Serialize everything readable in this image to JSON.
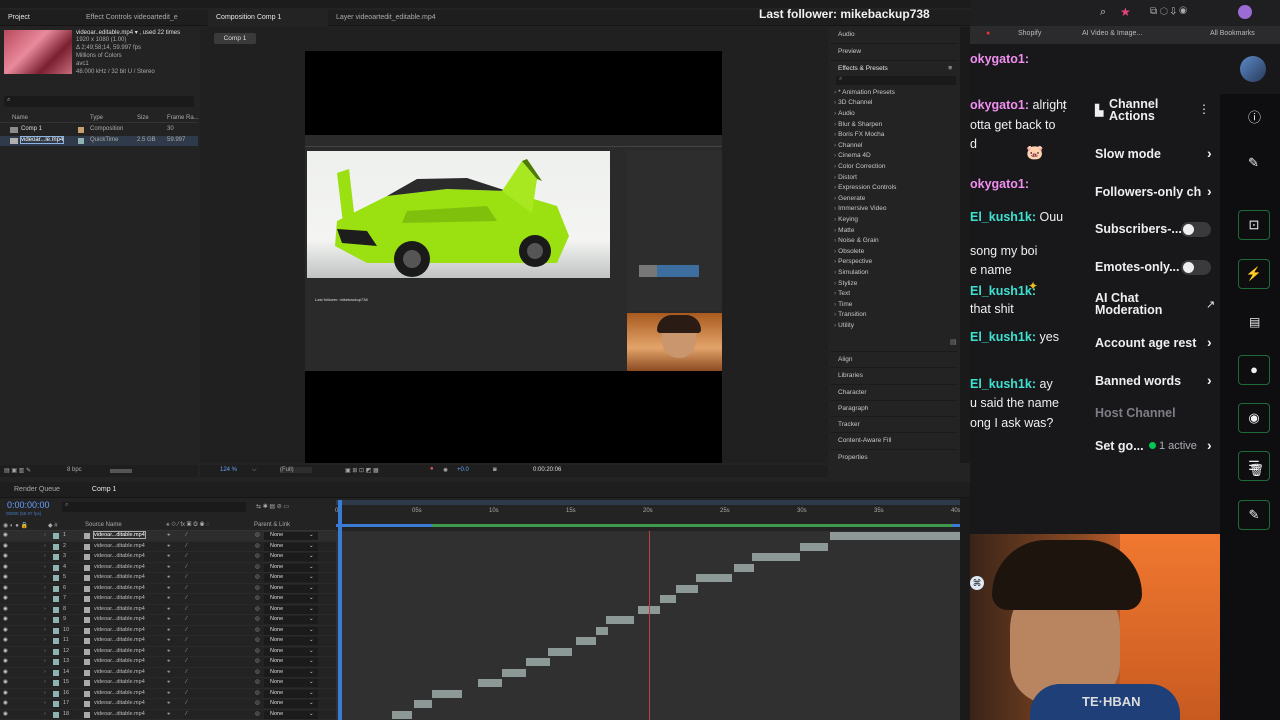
{
  "overlay": {
    "last_follower": "Last follower: mikebackup738"
  },
  "ae": {
    "tabs": {
      "project": "Project",
      "effect_controls": "Effect Controls videoartedit_e",
      "composition": "Composition Comp 1",
      "layer": "Layer videoartedit_editable.mp4"
    },
    "comp_chip": "Comp 1",
    "footage_info": {
      "name": "videoar..editable.mp4 ▾ , used 22 times",
      "res": "1920 x 1080 (1.00)",
      "dur": "Δ 2;49;58;14, 59.997 fps",
      "colors": "Millions of Colors",
      "codec": "avc1",
      "audio": "48.000 kHz / 32 bit U / Stereo"
    },
    "project_headers": {
      "name": "Name",
      "type": "Type",
      "size": "Size",
      "frame": "Frame Ra..."
    },
    "project_items": [
      {
        "name": "Comp 1",
        "type": "Composition",
        "size": "",
        "frame": "30"
      },
      {
        "name": "videoar...le.mp4",
        "type": "QuickTime",
        "size": "2.5 GB",
        "frame": "59.997"
      }
    ],
    "bpc": "8 bpc",
    "viewer": {
      "zoom": "124 %",
      "quality": "(Full)",
      "timecode": "0:00:20:06",
      "exposure": "+0.0"
    },
    "right_panels": {
      "audio": "Audio",
      "preview": "Preview",
      "effects_presets": "Effects & Presets"
    },
    "effects": [
      "* Animation Presets",
      "3D Channel",
      "Audio",
      "Blur & Sharpen",
      "Boris FX Mocha",
      "Channel",
      "Cinema 4D",
      "Color Correction",
      "Distort",
      "Expression Controls",
      "Generate",
      "Immersive Video",
      "Keying",
      "Matte",
      "Noise & Grain",
      "Obsolete",
      "Perspective",
      "Simulation",
      "Stylize",
      "Text",
      "Time",
      "Transition",
      "Utility"
    ],
    "lower_panels": [
      "Align",
      "Libraries",
      "Character",
      "Paragraph",
      "Tracker",
      "Content-Aware Fill",
      "Properties"
    ],
    "timeline": {
      "render_queue": "Render Queue",
      "comp_tab": "Comp 1",
      "timecode": "0:00:00:00",
      "timecode_sub": "00000 (59.97 fps)",
      "col_source": "Source Name",
      "col_parent": "Parent & Link",
      "ruler": [
        "0s",
        "05s",
        "10s",
        "15s",
        "20s",
        "25s",
        "30s",
        "35s",
        "40s"
      ],
      "layers": [
        {
          "num": "1",
          "name": "videoar...ditable.mp4",
          "parent": "None"
        },
        {
          "num": "2",
          "name": "videoar...ditable.mp4",
          "parent": "None"
        },
        {
          "num": "3",
          "name": "videoar...ditable.mp4",
          "parent": "None"
        },
        {
          "num": "4",
          "name": "videoar...ditable.mp4",
          "parent": "None"
        },
        {
          "num": "5",
          "name": "videoar...ditable.mp4",
          "parent": "None"
        },
        {
          "num": "6",
          "name": "videoar...ditable.mp4",
          "parent": "None"
        },
        {
          "num": "7",
          "name": "videoar...ditable.mp4",
          "parent": "None"
        },
        {
          "num": "8",
          "name": "videoar...ditable.mp4",
          "parent": "None"
        },
        {
          "num": "9",
          "name": "videoar...ditable.mp4",
          "parent": "None"
        },
        {
          "num": "10",
          "name": "videoar...ditable.mp4",
          "parent": "None"
        },
        {
          "num": "11",
          "name": "videoar...ditable.mp4",
          "parent": "None"
        },
        {
          "num": "12",
          "name": "videoar...ditable.mp4",
          "parent": "None"
        },
        {
          "num": "13",
          "name": "videoar...ditable.mp4",
          "parent": "None"
        },
        {
          "num": "14",
          "name": "videoar...ditable.mp4",
          "parent": "None"
        },
        {
          "num": "15",
          "name": "videoar...ditable.mp4",
          "parent": "None"
        },
        {
          "num": "16",
          "name": "videoar...ditable.mp4",
          "parent": "None"
        },
        {
          "num": "17",
          "name": "videoar...ditable.mp4",
          "parent": "None"
        },
        {
          "num": "18",
          "name": "videoar...ditable.mp4",
          "parent": "None"
        }
      ]
    },
    "inner_watermark": "Last follower: mikebackup738"
  },
  "browser": {
    "shopify": "Shopify",
    "ai_video": "AI Video & Image...",
    "all_bookmarks": "All Bookmarks"
  },
  "chat": {
    "lines": [
      {
        "user": "okygato1:",
        "text": ""
      },
      {
        "user": "okygato1:",
        "text": " alright"
      },
      {
        "user": "",
        "text": "otta get back to"
      },
      {
        "user": "",
        "text": "d"
      },
      {
        "user": "okygato1:",
        "text": ""
      },
      {
        "user": "El_kush1k:",
        "text": " Ouu"
      },
      {
        "user": "",
        "text": "song my boi"
      },
      {
        "user": "",
        "text": "e name"
      },
      {
        "user": "El_kush1k:",
        "text": ""
      },
      {
        "user": "",
        "text": "that shit"
      },
      {
        "user": "El_kush1k:",
        "text": " yes"
      },
      {
        "user": "El_kush1k:",
        "text": " ay"
      },
      {
        "user": "",
        "text": "u said the name"
      },
      {
        "user": "",
        "text": "ong I ask was?"
      }
    ]
  },
  "channel_actions": {
    "title_line1": "Channel",
    "title_line2": "Actions",
    "items": [
      {
        "label": "Slow mode"
      },
      {
        "label": "Followers-only ch"
      },
      {
        "label": "Subscribers-..."
      },
      {
        "label": "Emotes-only..."
      },
      {
        "label": "AI Chat"
      },
      {
        "label": "Moderation"
      },
      {
        "label": "Account age rest"
      },
      {
        "label": "Banned words"
      },
      {
        "label": "Host Channel"
      },
      {
        "label": "Set go..."
      }
    ],
    "active_count": "1 active",
    "green": "#00c853"
  }
}
